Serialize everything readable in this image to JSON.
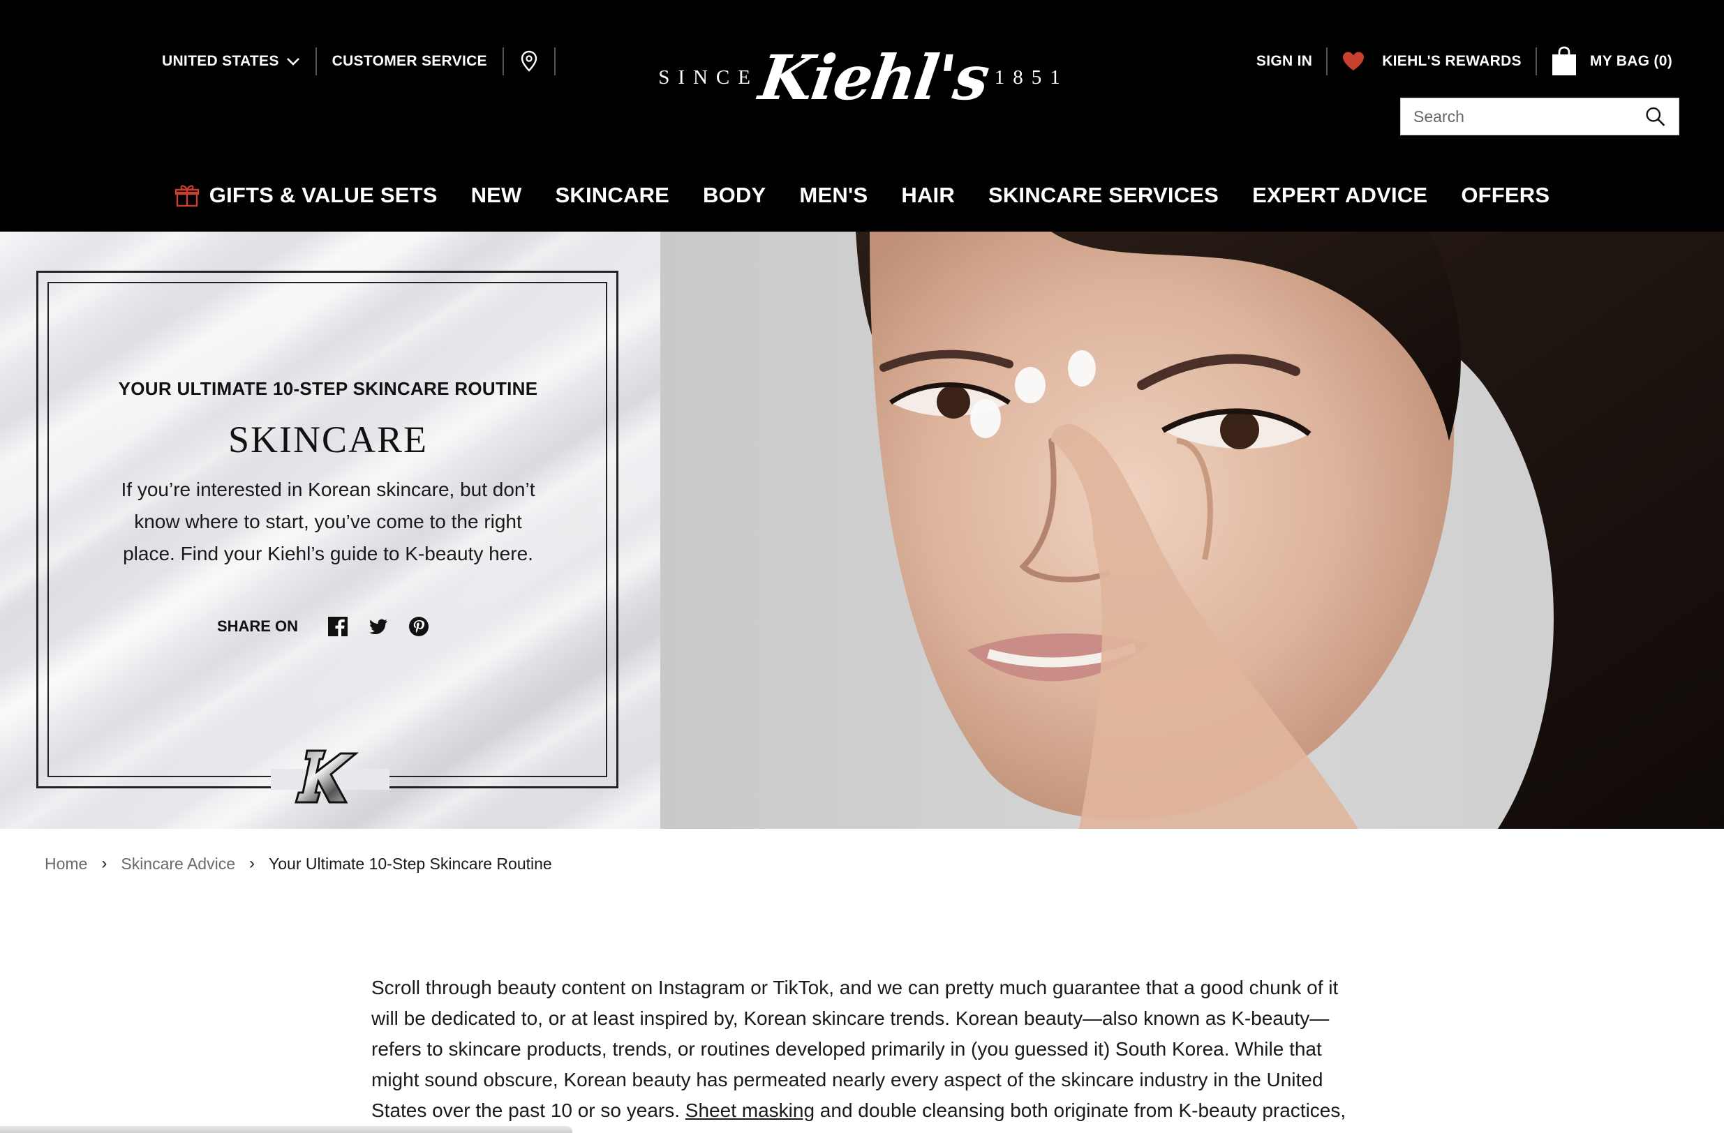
{
  "header": {
    "country": "UNITED STATES",
    "customer_service": "CUSTOMER SERVICE",
    "logo": {
      "since": "SINCE",
      "brand": "Kiehl's",
      "year": "1851"
    },
    "sign_in": "SIGN IN",
    "rewards": "KIEHL'S REWARDS",
    "bag": "MY BAG (0)",
    "search_placeholder": "Search",
    "icons": {
      "location": "map-pin-icon",
      "rewards": "heart-icon",
      "bag": "shopping-bag-icon",
      "search": "search-icon",
      "gift": "gift-icon"
    },
    "accent": "#c8402e"
  },
  "nav": {
    "items": [
      "GIFTS & VALUE SETS",
      "NEW",
      "SKINCARE",
      "BODY",
      "MEN'S",
      "HAIR",
      "SKINCARE SERVICES",
      "EXPERT ADVICE",
      "OFFERS"
    ]
  },
  "hero": {
    "kicker": "YOUR ULTIMATE 10-STEP SKINCARE ROUTINE",
    "title": "SKINCARE",
    "description": "If you’re interested in Korean skincare, but don’t know where to start, you’ve come to the right place. Find your Kiehl’s guide to K-beauty here.",
    "share_label": "SHARE ON",
    "share_icons": [
      "facebook-icon",
      "twitter-icon",
      "pinterest-icon"
    ]
  },
  "breadcrumb": {
    "items": [
      "Home",
      "Skincare Advice",
      "Your Ultimate 10-Step Skincare Routine"
    ]
  },
  "article": {
    "p1_before_link": "Scroll through beauty content on Instagram or TikTok, and we can pretty much guarantee that a good chunk of it will be dedicated to, or at least inspired by, Korean skincare trends. Korean beauty—also known as K-beauty—refers to skincare products, trends, or routines developed primarily in (you guessed it) South Korea. While that might sound obscure, Korean beauty has permeated nearly every aspect of the skincare industry in the United States over the past 10 or so years. ",
    "p1_link": "Sheet masking",
    "p1_after_link": " and double cleansing both originate from K-beauty practices,"
  }
}
